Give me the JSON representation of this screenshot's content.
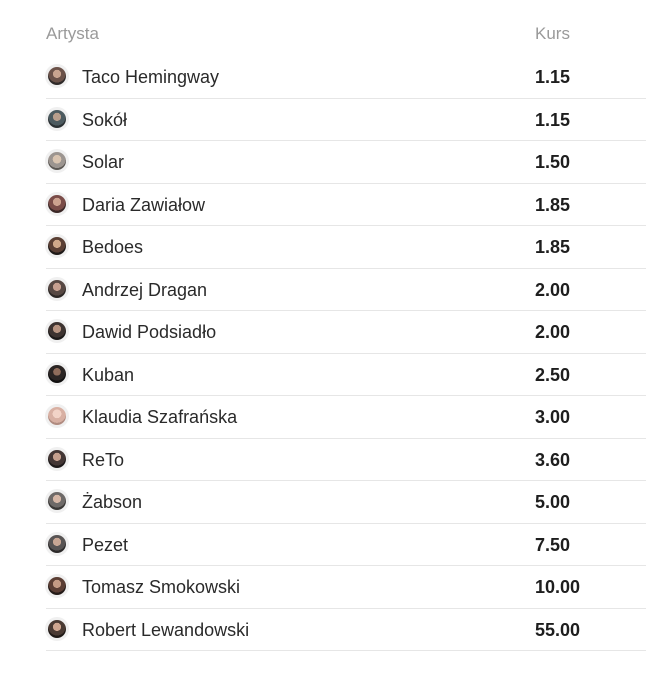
{
  "table": {
    "headers": {
      "artist": "Artysta",
      "odds": "Kurs"
    },
    "rows": [
      {
        "name": "Taco Hemingway",
        "odds": "1.15"
      },
      {
        "name": "Sokół",
        "odds": "1.15"
      },
      {
        "name": "Solar",
        "odds": "1.50"
      },
      {
        "name": "Daria Zawiałow",
        "odds": "1.85"
      },
      {
        "name": "Bedoes",
        "odds": "1.85"
      },
      {
        "name": "Andrzej Dragan",
        "odds": "2.00"
      },
      {
        "name": "Dawid Podsiadło",
        "odds": "2.00"
      },
      {
        "name": "Kuban",
        "odds": "2.50"
      },
      {
        "name": "Klaudia Szafrańska",
        "odds": "3.00"
      },
      {
        "name": "ReTo",
        "odds": "3.60"
      },
      {
        "name": "Żabson",
        "odds": "5.00"
      },
      {
        "name": "Pezet",
        "odds": "7.50"
      },
      {
        "name": "Tomasz Smokowski",
        "odds": "10.00"
      },
      {
        "name": "Robert Lewandowski",
        "odds": "55.00"
      }
    ]
  }
}
